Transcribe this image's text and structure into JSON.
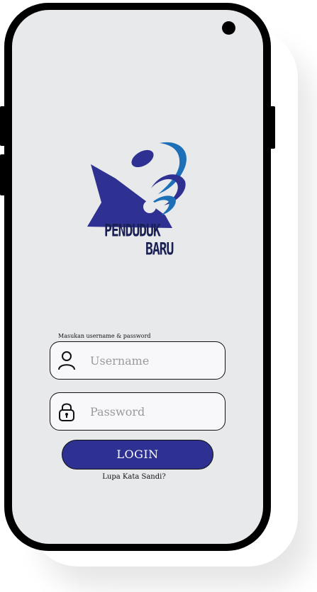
{
  "app": {
    "logo_line1": "PENDUDUK",
    "logo_line2": "BARU"
  },
  "login": {
    "hint": "Masukan username & password",
    "username_placeholder": "Username",
    "username_value": "",
    "password_placeholder": "Password",
    "password_value": "",
    "login_label": "LOGIN",
    "forgot_label": "Lupa Kata Sandi?"
  },
  "icons": {
    "user": "user-icon",
    "lock": "lock-icon"
  },
  "colors": {
    "brand_primary": "#2e3192",
    "brand_accent": "#1d6fb8",
    "screen_bg": "#e8e9ea",
    "field_bg": "#f8f8fb"
  }
}
